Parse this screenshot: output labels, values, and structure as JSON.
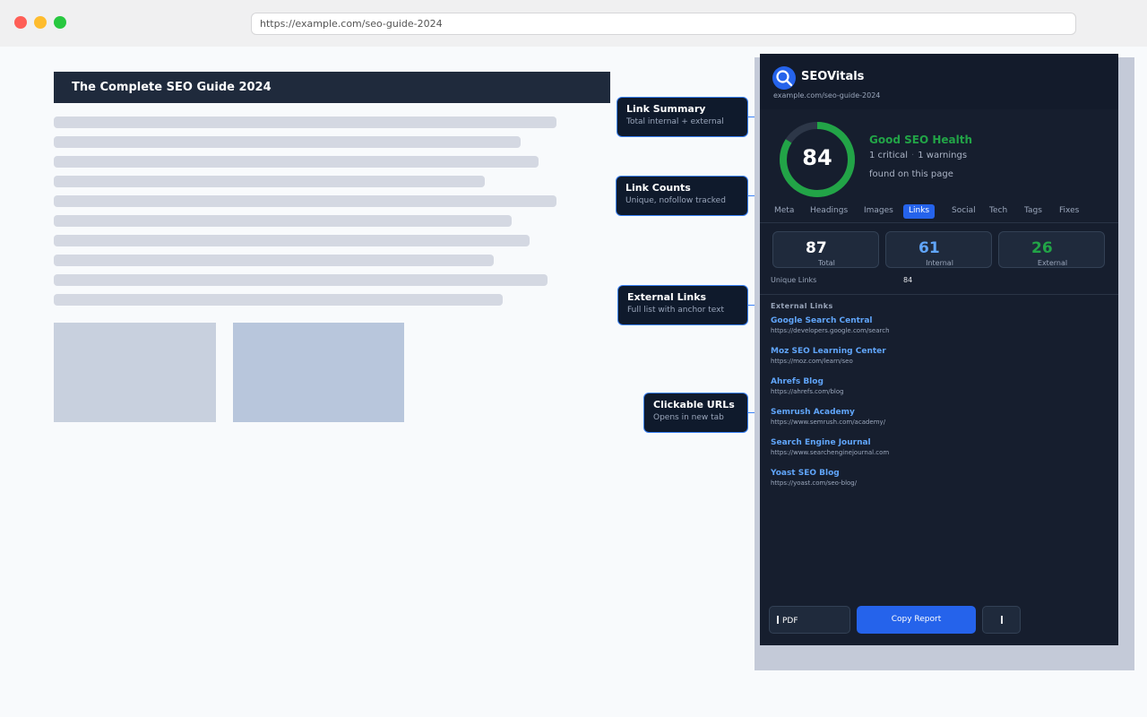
{
  "browser": {
    "url": "https://example.com/seo-guide-2024"
  },
  "page": {
    "title": "The Complete SEO Guide 2024"
  },
  "callouts": [
    {
      "title": "Link Summary",
      "subtitle": "Total internal + external"
    },
    {
      "title": "Link Counts",
      "subtitle": "Unique, nofollow tracked"
    },
    {
      "title": "External Links",
      "subtitle": "Full list with anchor text"
    },
    {
      "title": "Clickable URLs",
      "subtitle": "Opens in new tab"
    }
  ],
  "extension": {
    "brand": "SEOVitals",
    "url": "example.com/seo-guide-2024",
    "score": "84",
    "score_fraction": 0.84,
    "health_label": "Good SEO Health",
    "critical": "1 critical",
    "warnings": "1 warnings",
    "found": "found on this page",
    "tabs": [
      "Meta",
      "Headings",
      "Images",
      "Links",
      "Social",
      "Tech",
      "Tags",
      "Fixes"
    ],
    "active_tab": "Links",
    "stats": [
      {
        "value": "87",
        "label": "Total"
      },
      {
        "value": "61",
        "label": "Internal"
      },
      {
        "value": "26",
        "label": "External"
      }
    ],
    "unique_links_label": "Unique Links",
    "unique_links_value": "84",
    "external_header": "External Links",
    "links": [
      {
        "title": "Google Search Central",
        "url": "https://developers.google.com/search"
      },
      {
        "title": "Moz SEO Learning Center",
        "url": "https://moz.com/learn/seo"
      },
      {
        "title": "Ahrefs Blog",
        "url": "https://ahrefs.com/blog"
      },
      {
        "title": "Semrush Academy",
        "url": "https://www.semrush.com/academy/"
      },
      {
        "title": "Search Engine Journal",
        "url": "https://www.searchenginejournal.com"
      },
      {
        "title": "Yoast SEO Blog",
        "url": "https://yoast.com/seo-blog/"
      }
    ],
    "buttons": {
      "pdf": "PDF",
      "copy": "Copy Report"
    }
  },
  "colors": {
    "accent": "#2563eb",
    "good": "#22a447",
    "panel": "#161e2e"
  }
}
